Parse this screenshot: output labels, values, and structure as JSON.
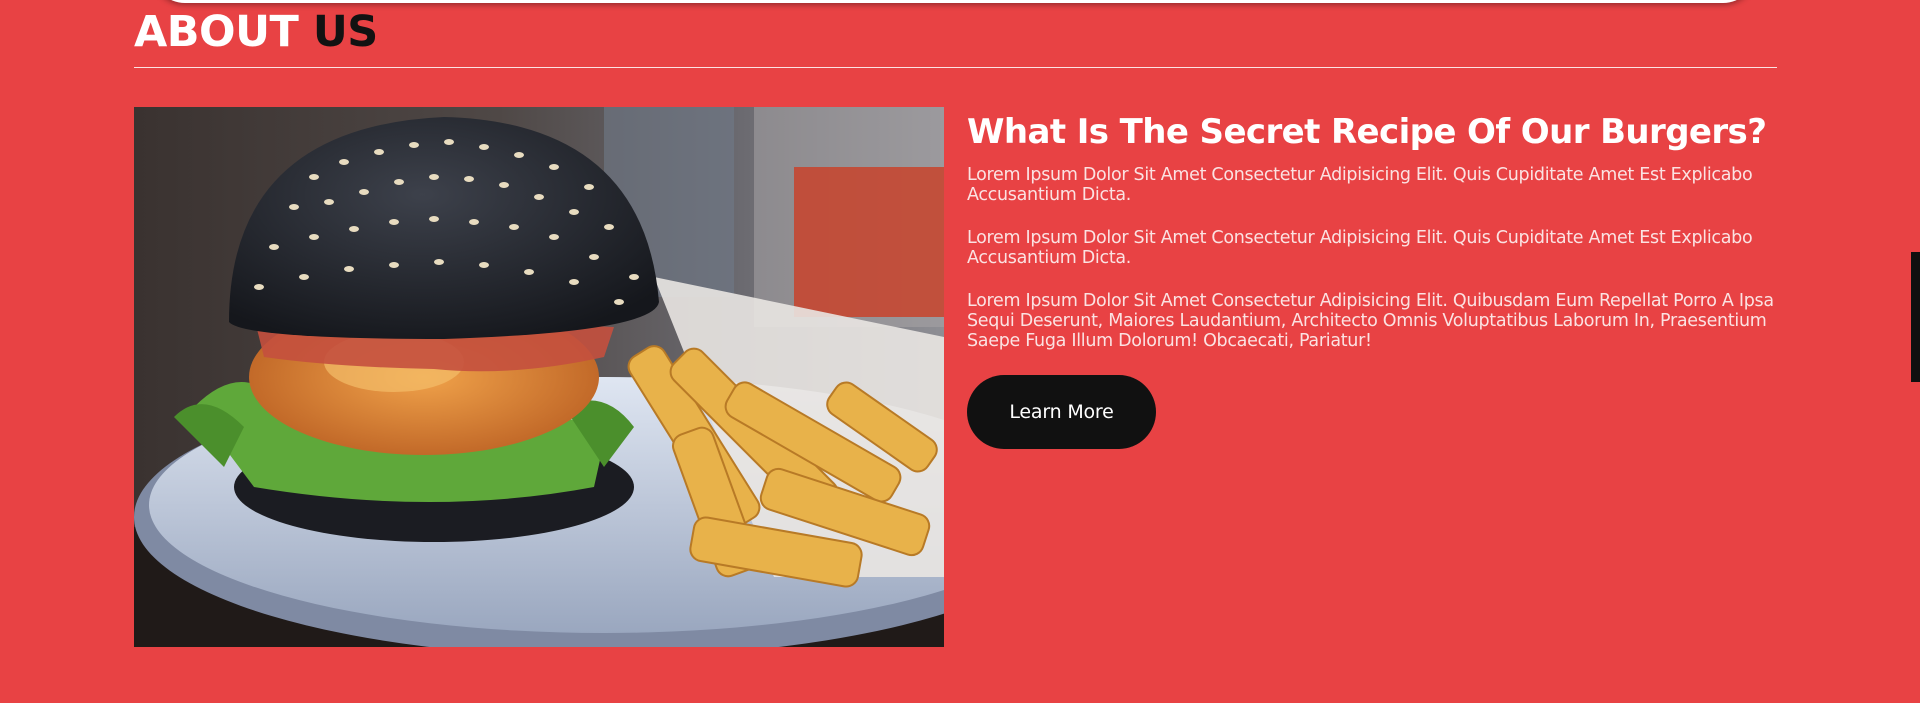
{
  "about": {
    "heading_main": "ABOUT",
    "heading_accent": "US"
  },
  "feature": {
    "title": "What Is The Secret Recipe Of Our Burgers?",
    "paragraphs": [
      "Lorem Ipsum Dolor Sit Amet Consectetur Adipisicing Elit. Quis Cupiditate Amet Est Explicabo Accusantium Dicta.",
      "Lorem Ipsum Dolor Sit Amet Consectetur Adipisicing Elit. Quis Cupiditate Amet Est Explicabo Accusantium Dicta.",
      "Lorem Ipsum Dolor Sit Amet Consectetur Adipisicing Elit. Quibusdam Eum Repellat Porro A Ipsa Sequi Deserunt, Maiores Laudantium, Architecto Omnis Voluptatibus Laborum In, Praesentium Saepe Fuga Illum Dolorum! Obcaecati, Pariatur!"
    ],
    "button_label": "Learn More",
    "image_icon": "burger-photo"
  },
  "colors": {
    "background": "#e84244",
    "accent_text": "#121212",
    "button": "#111111"
  }
}
